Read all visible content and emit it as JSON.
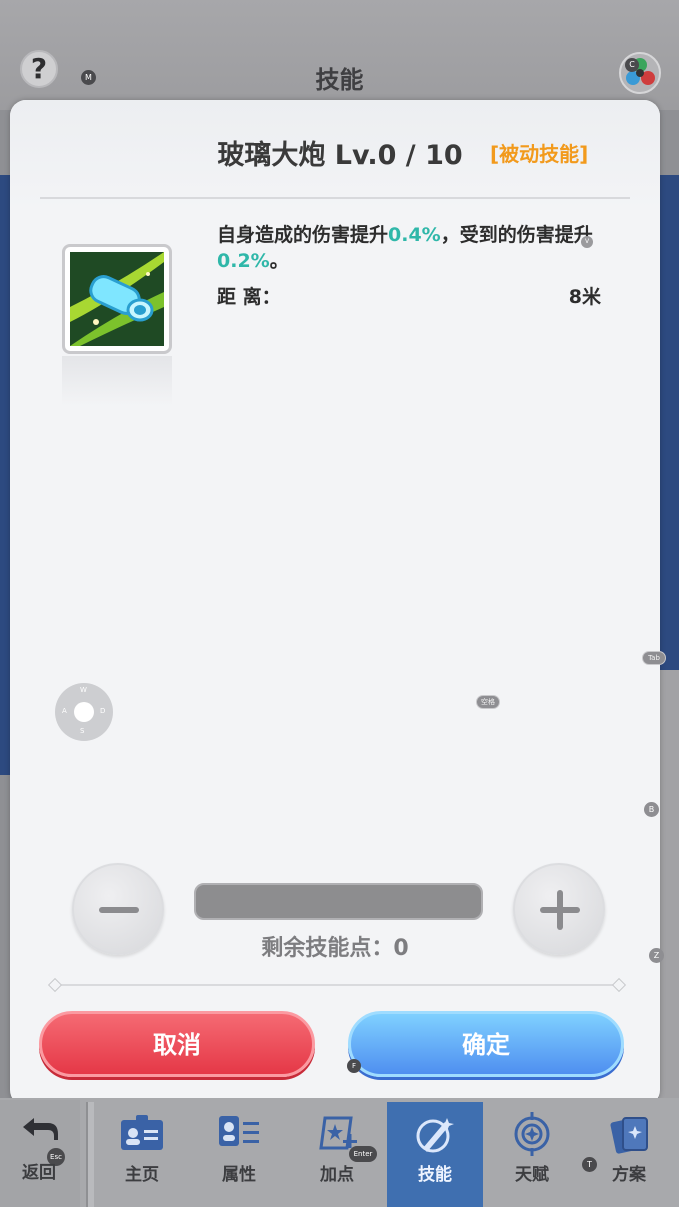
{
  "background": {
    "title": "技能",
    "help_label": "?",
    "key_help": "M",
    "key_element": "C",
    "side_badges": [
      "Tab",
      "B",
      "Z"
    ],
    "key_space": "空格",
    "key_f": "F",
    "key_t": "T"
  },
  "modal": {
    "skill_name": "玻璃大炮 Lv.0 / 10",
    "skill_type": "[被动技能]",
    "description_parts": [
      "自身造成的伤害提升",
      "0.4%",
      "，受到的伤害提升",
      "0.2%",
      "。"
    ],
    "range_label": "距 离：",
    "range_value": "8米",
    "key_v": "V",
    "joystick": {
      "w": "W",
      "a": "A",
      "s": "S",
      "d": "D"
    },
    "remaining_points_text": "剩余技能点：0",
    "remaining_points": 0,
    "level_progress": 0.0,
    "cancel_label": "取消",
    "confirm_label": "确定"
  },
  "nav": {
    "back_label": "返回",
    "back_key": "Esc",
    "enter_key": "Enter",
    "items": [
      {
        "label": "主页",
        "icon": "profile-card-icon",
        "active": false
      },
      {
        "label": "属性",
        "icon": "attributes-icon",
        "active": false
      },
      {
        "label": "加点",
        "icon": "add-points-icon",
        "active": false
      },
      {
        "label": "技能",
        "icon": "skill-icon",
        "active": true
      },
      {
        "label": "天赋",
        "icon": "talent-icon",
        "active": false
      },
      {
        "label": "方案",
        "icon": "cards-icon",
        "active": false
      }
    ]
  },
  "colors": {
    "highlight": "#2fb7a9",
    "skill_type": "#f29a1c",
    "cancel": "#e53847",
    "confirm": "#4f8ff0",
    "nav_active": "#3f6fb0"
  }
}
